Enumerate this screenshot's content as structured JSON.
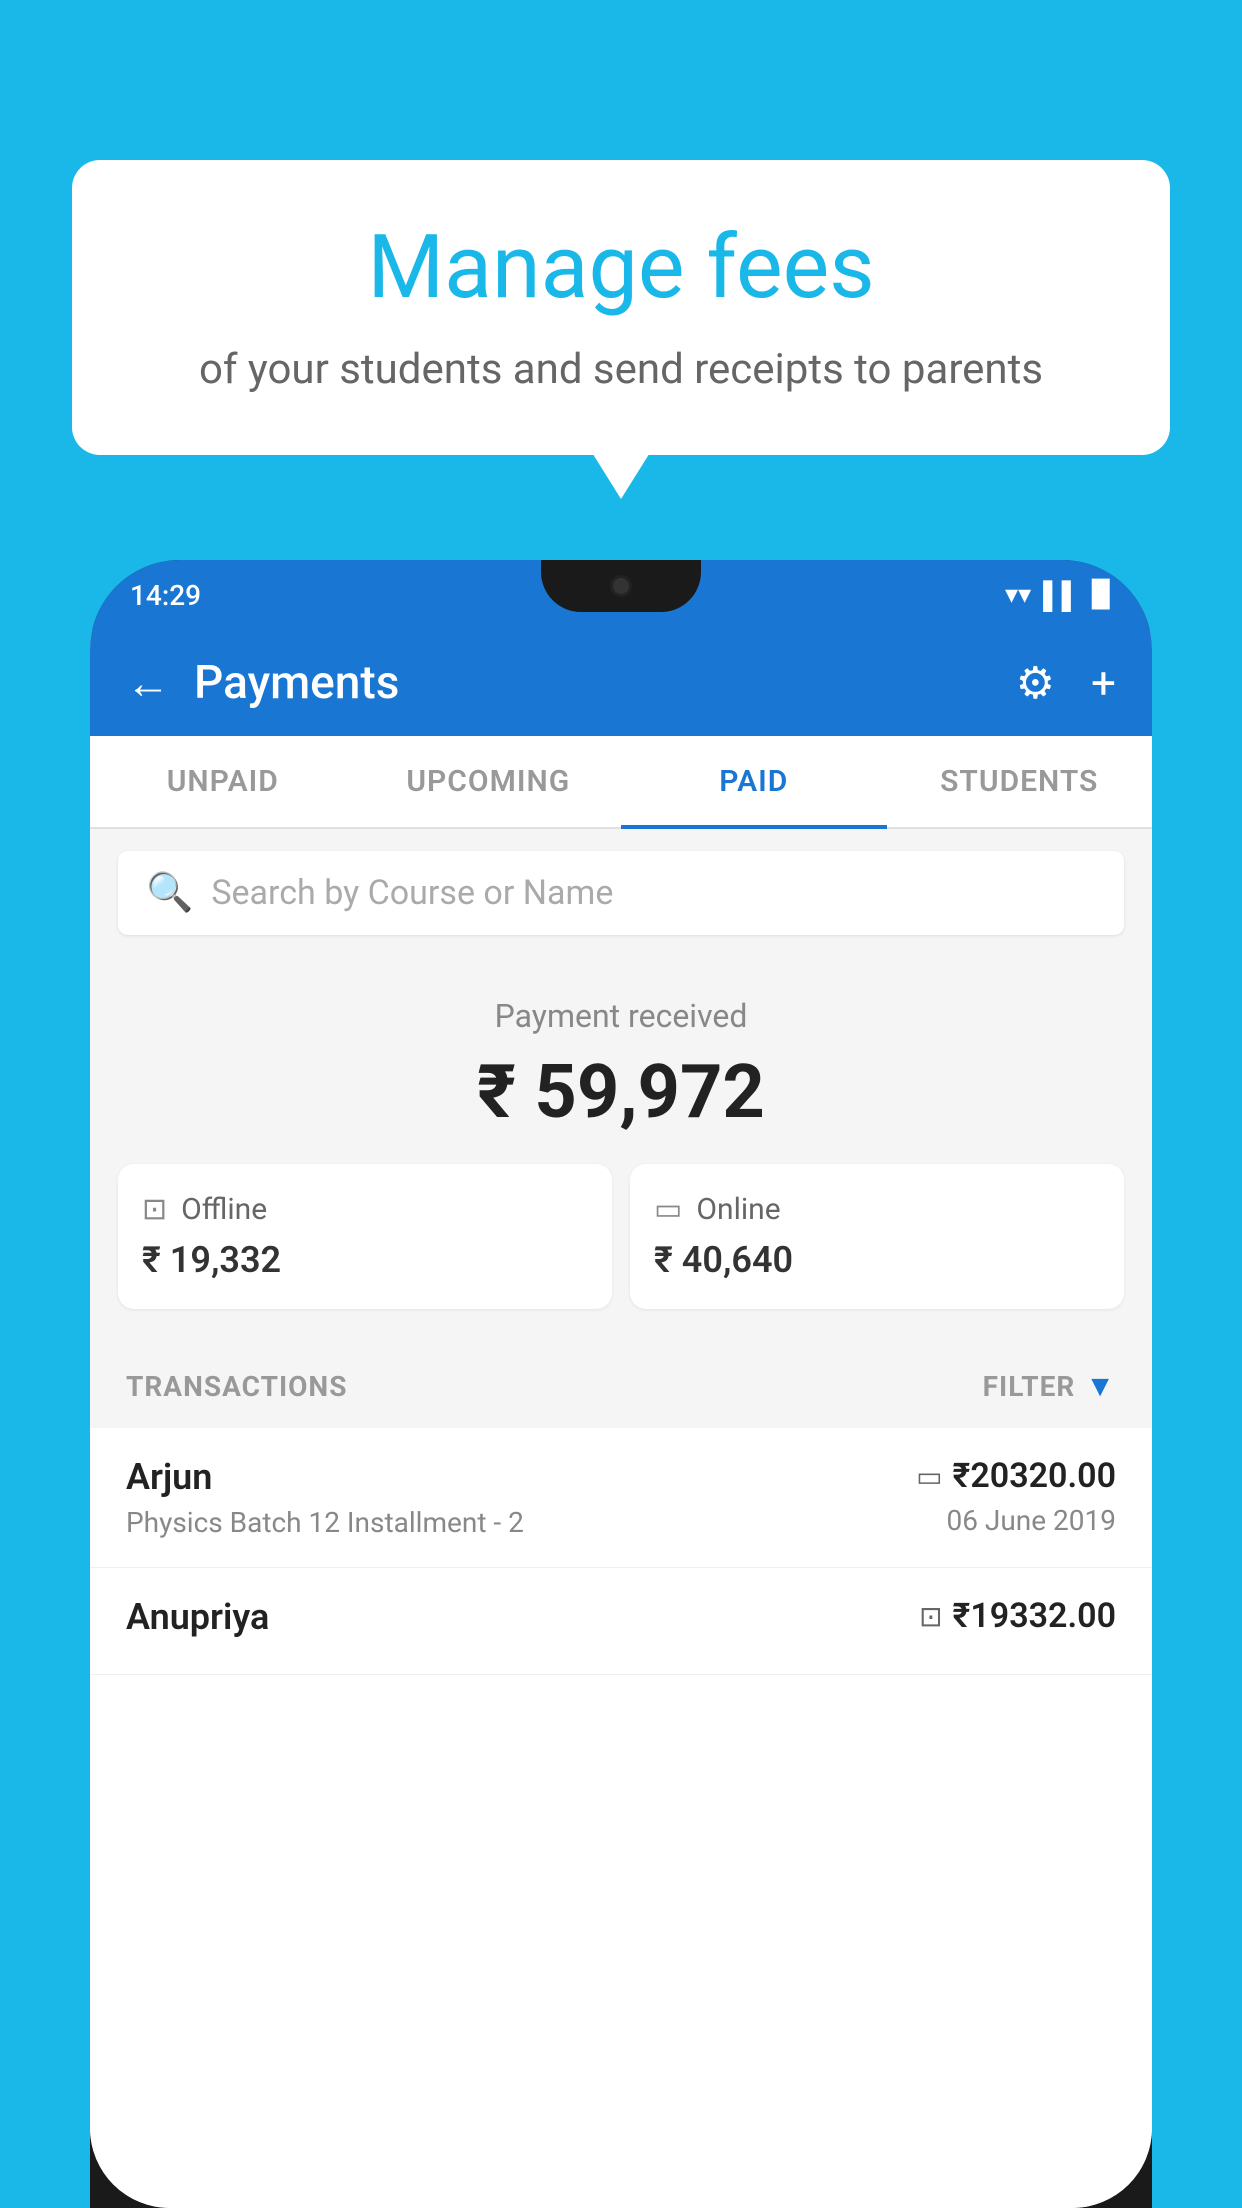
{
  "background_color": "#1ab8e8",
  "bubble": {
    "title": "Manage fees",
    "subtitle": "of your students and send receipts to parents"
  },
  "status_bar": {
    "time": "14:29",
    "wifi": "▲",
    "signal": "▲",
    "battery": "▉"
  },
  "header": {
    "title": "Payments",
    "back_label": "←",
    "plus_label": "+"
  },
  "tabs": [
    {
      "label": "UNPAID",
      "active": false
    },
    {
      "label": "UPCOMING",
      "active": false
    },
    {
      "label": "PAID",
      "active": true
    },
    {
      "label": "STUDENTS",
      "active": false
    }
  ],
  "search": {
    "placeholder": "Search by Course or Name"
  },
  "payment_summary": {
    "label": "Payment received",
    "total_amount": "₹ 59,972",
    "offline": {
      "type": "Offline",
      "amount": "₹ 19,332"
    },
    "online": {
      "type": "Online",
      "amount": "₹ 40,640"
    }
  },
  "transactions": {
    "label": "TRANSACTIONS",
    "filter_label": "FILTER",
    "rows": [
      {
        "name": "Arjun",
        "detail": "Physics Batch 12 Installment - 2",
        "amount": "₹20320.00",
        "date": "06 June 2019",
        "payment_type": "card"
      },
      {
        "name": "Anupriya",
        "detail": "",
        "amount": "₹19332.00",
        "date": "",
        "payment_type": "offline"
      }
    ]
  }
}
